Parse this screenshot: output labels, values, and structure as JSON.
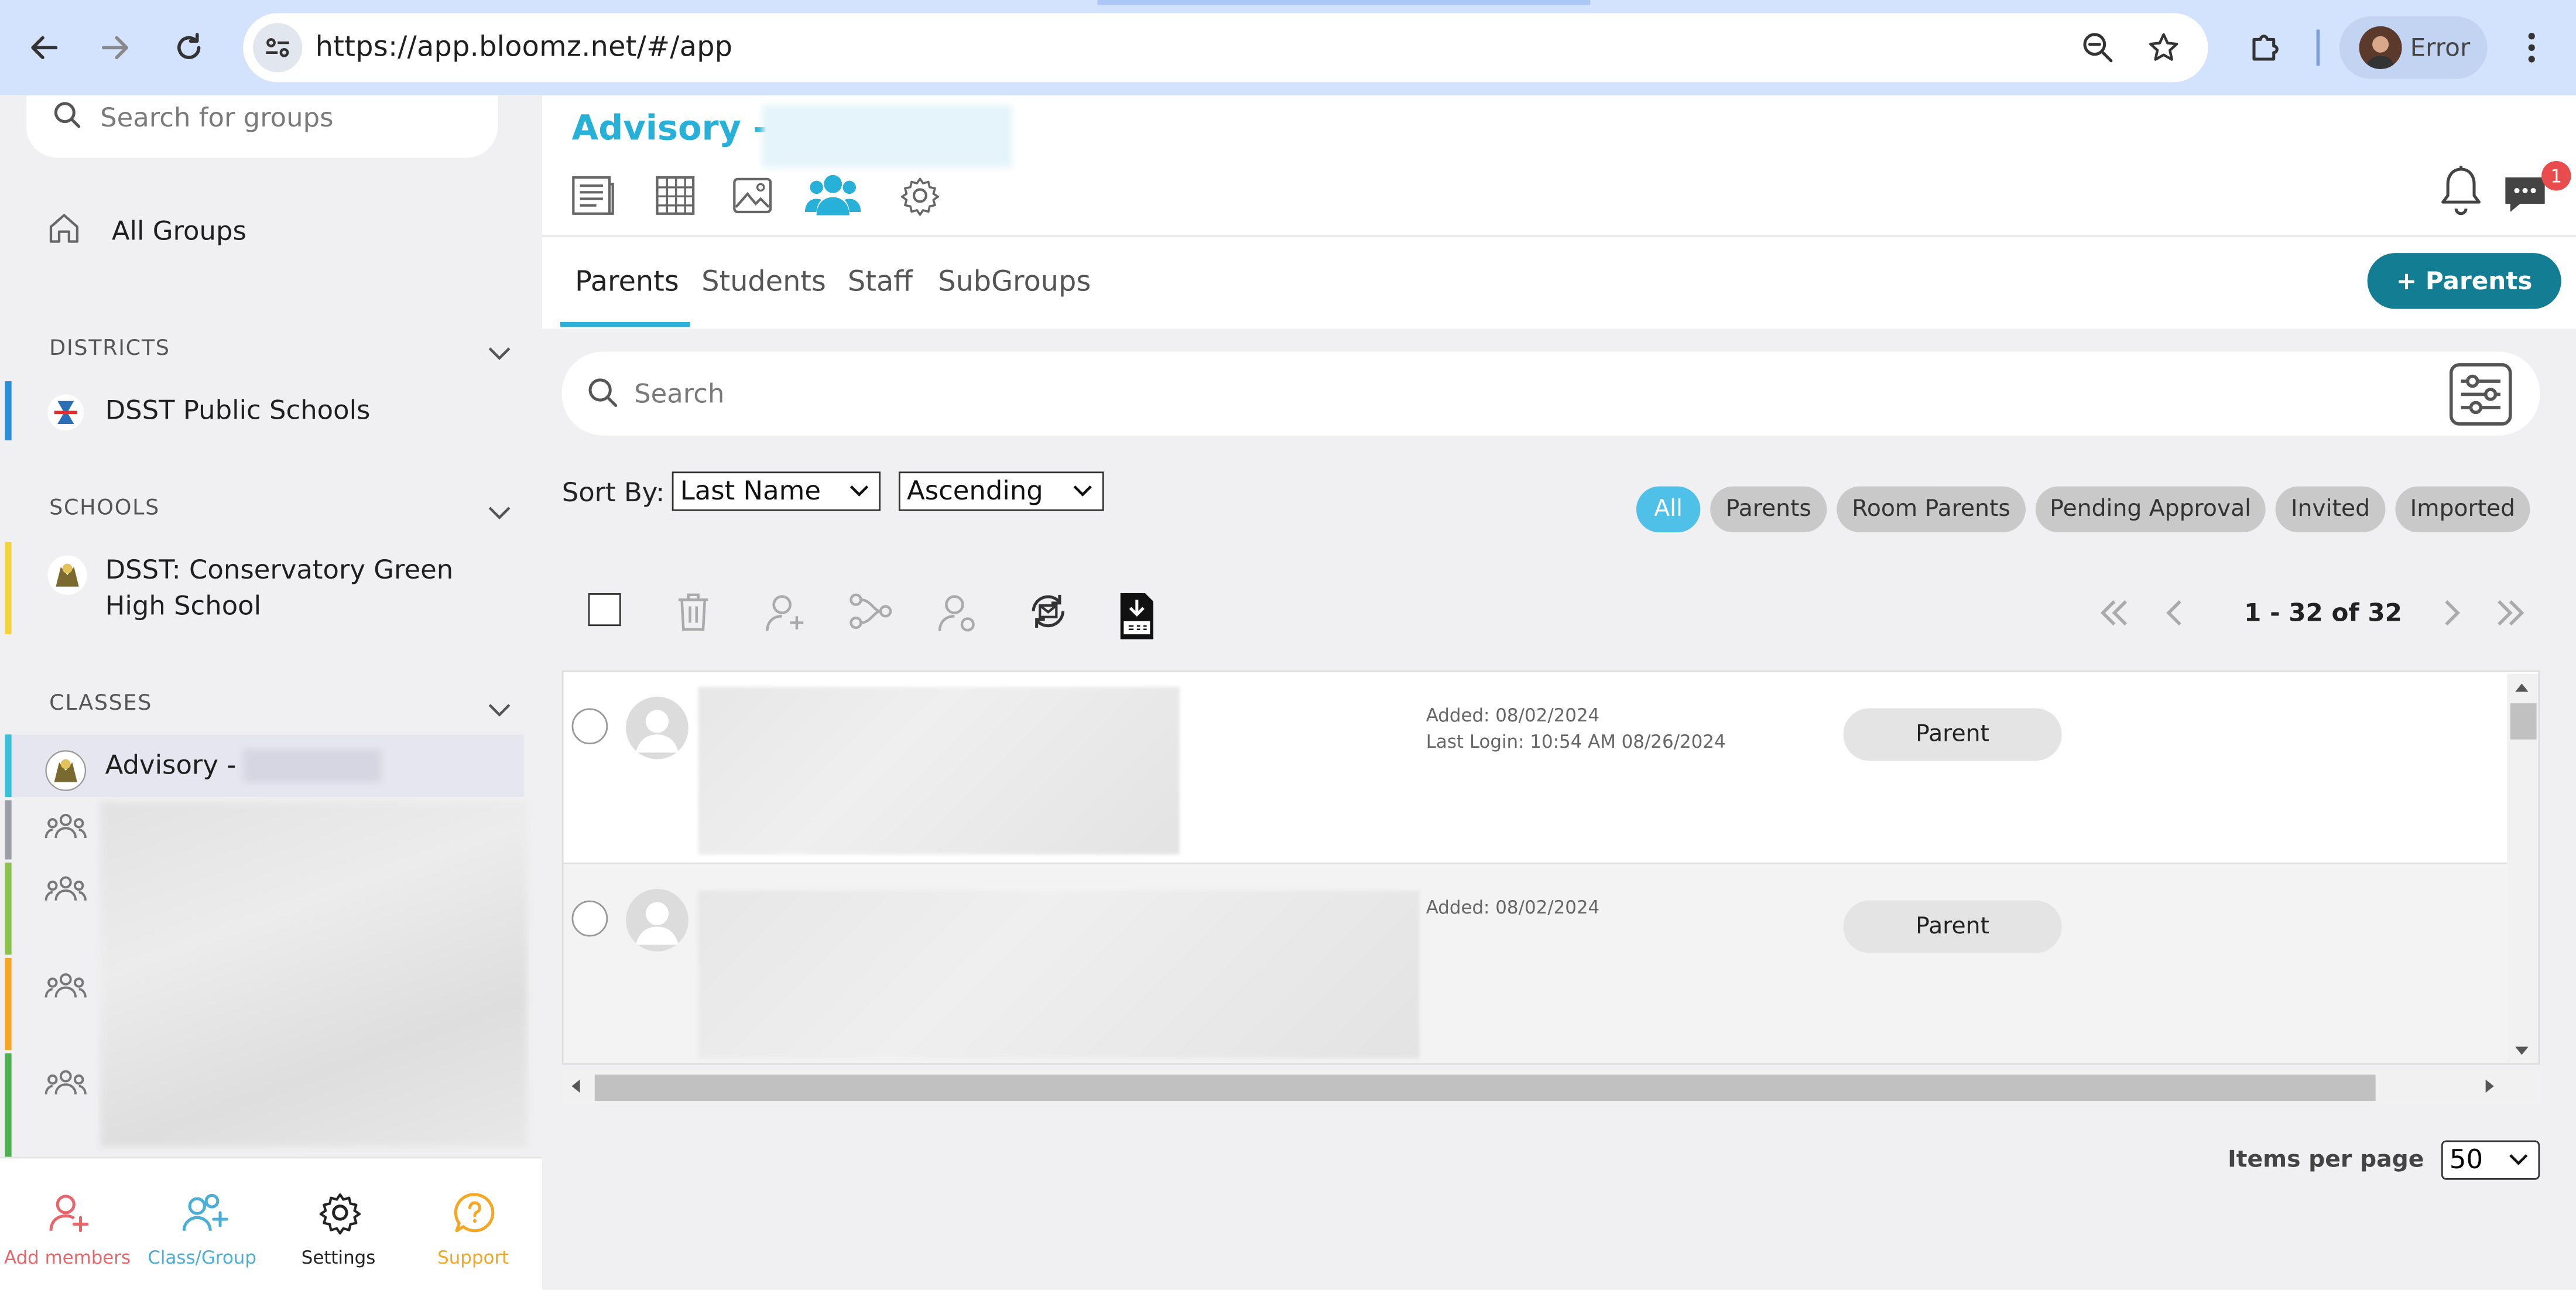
{
  "browser": {
    "url": "https://app.bloomz.net/#/app",
    "profile_label": "Error"
  },
  "sidebar": {
    "search_placeholder": "Search for groups",
    "all_groups": "All Groups",
    "districts_heading": "DISTRICTS",
    "district_name": "DSST Public Schools",
    "schools_heading": "SCHOOLS",
    "school_name_line1": "DSST: Conservatory Green",
    "school_name_line2": "High School",
    "classes_heading": "CLASSES",
    "class_name": "Advisory -",
    "bottom_nav": {
      "add_members": "Add members",
      "class_group": "Class/Group",
      "settings": "Settings",
      "support": "Support"
    }
  },
  "header": {
    "title": "Advisory -",
    "notification_badge": "1"
  },
  "tabs": {
    "parents": "Parents",
    "students": "Students",
    "staff": "Staff",
    "subgroups": "SubGroups"
  },
  "add_parents_button": "+ Parents",
  "search_placeholder": "Search",
  "sort": {
    "label": "Sort By:",
    "field": "Last Name",
    "order": "Ascending"
  },
  "filters": [
    "All",
    "Parents",
    "Room Parents",
    "Pending Approval",
    "Invited",
    "Imported"
  ],
  "pagination": {
    "range": "1 - 32 of 32"
  },
  "rows": [
    {
      "added": "Added: 08/02/2024",
      "last_login": "Last Login: 10:54 AM 08/26/2024",
      "role": "Parent"
    },
    {
      "added": "Added: 08/02/2024",
      "last_login": "",
      "role": "Parent"
    }
  ],
  "items_per_page": {
    "label": "Items per page",
    "value": "50"
  },
  "colors": {
    "accent": "#27b0d8",
    "primary_button": "#137e93",
    "chip_active": "#4fc1e9",
    "add_members": "#e8656a",
    "class_group": "#4aaed6",
    "support": "#f5a623"
  }
}
